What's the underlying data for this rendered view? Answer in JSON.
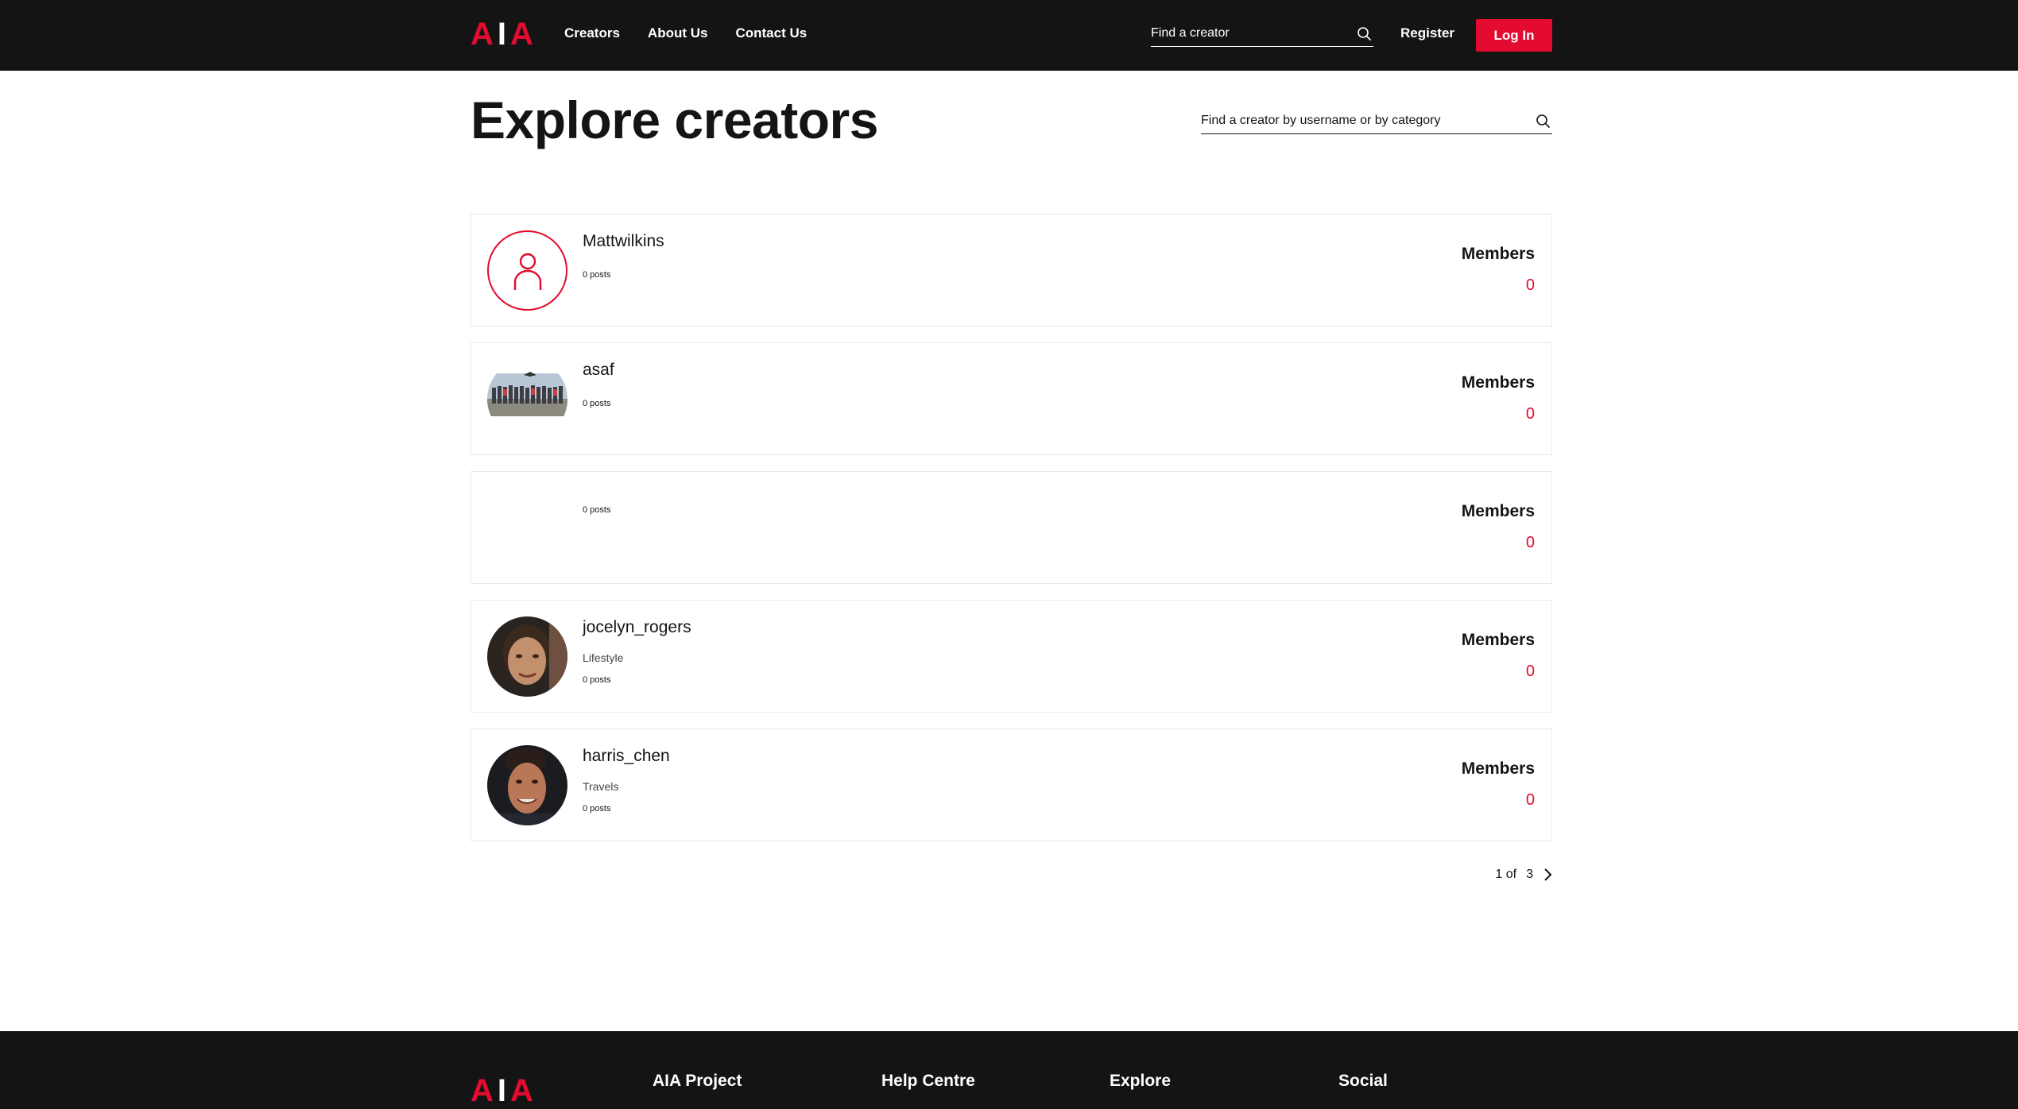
{
  "header": {
    "logo": {
      "left": "A",
      "mid": "I",
      "right": "A"
    },
    "nav": [
      "Creators",
      "About Us",
      "Contact Us"
    ],
    "search_placeholder": "Find a creator",
    "register": "Register",
    "login": "Log In"
  },
  "main": {
    "title": "Explore creators",
    "search_placeholder": "Find a creator by username or by category"
  },
  "creators": [
    {
      "name": "Mattwilkins",
      "category": "",
      "posts": "0 posts",
      "members_label": "Members",
      "members": "0",
      "avatar": "placeholder"
    },
    {
      "name": "asaf",
      "category": "",
      "posts": "0 posts",
      "members_label": "Members",
      "members": "0",
      "avatar": "group-photo"
    },
    {
      "name": "",
      "category": "",
      "posts": "0 posts",
      "members_label": "Members",
      "members": "0",
      "avatar": "none"
    },
    {
      "name": "jocelyn_rogers",
      "category": "Lifestyle",
      "posts": "0 posts",
      "members_label": "Members",
      "members": "0",
      "avatar": "portrait"
    },
    {
      "name": "harris_chen",
      "category": "Travels",
      "posts": "0 posts",
      "members_label": "Members",
      "members": "0",
      "avatar": "portrait"
    }
  ],
  "pagination": {
    "current": "1",
    "of": "of",
    "total": "3"
  },
  "footer": {
    "logo": {
      "left": "A",
      "mid": "I",
      "right": "A"
    },
    "columns": [
      "AIA Project",
      "Help Centre",
      "Explore",
      "Social"
    ]
  },
  "colors": {
    "accent": "#e30b2f",
    "dark": "#141414"
  }
}
